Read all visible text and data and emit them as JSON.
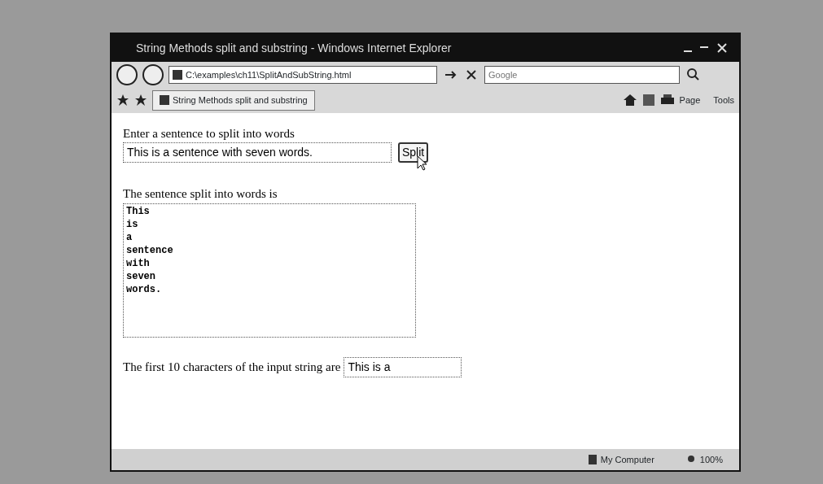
{
  "window": {
    "title": "String Methods split and substring - Windows Internet Explorer"
  },
  "address_bar": {
    "url": "C:\\examples\\ch11\\SplitAndSubString.html"
  },
  "search": {
    "placeholder": "Google"
  },
  "tab": {
    "label": "String Methods split and substring",
    "selected": true
  },
  "toolbar": [
    "Page",
    "Tools"
  ],
  "page": {
    "prompt": "Enter a sentence to split into words",
    "input_value": "This is a sentence with seven words.",
    "button": "Split",
    "result_label": "The sentence split into words is",
    "words": [
      "This",
      "is",
      "a",
      "sentence",
      "with",
      "seven",
      "words."
    ],
    "substring_label": "The first 10 characters of the input string are",
    "substring_value": "This is a"
  },
  "status_bar": {
    "zone": "My Computer",
    "zoom": "100%"
  }
}
